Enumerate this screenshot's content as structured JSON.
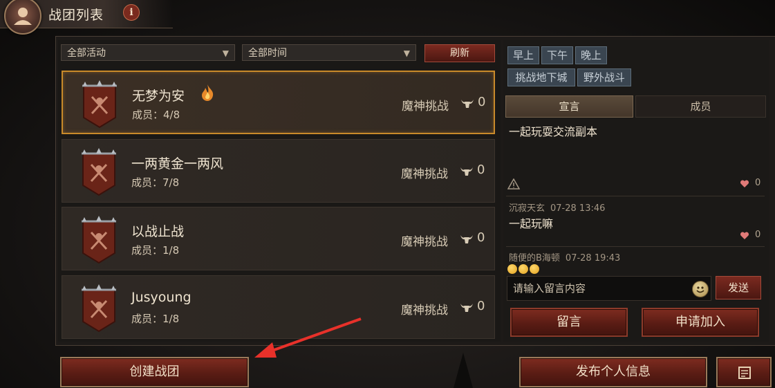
{
  "header": {
    "title": "战团列表",
    "info_label": "i"
  },
  "filters": {
    "activity": "全部活动",
    "time": "全部时间",
    "arrow": "▼",
    "refresh_label": "刷新"
  },
  "teams": [
    {
      "name": "无梦为安",
      "members": "成员：4/8",
      "activity": "魔神挑战",
      "count": "0",
      "selected": true,
      "hot": true
    },
    {
      "name": "一两黄金一两风",
      "members": "成员：7/8",
      "activity": "魔神挑战",
      "count": "0",
      "selected": false,
      "hot": false
    },
    {
      "name": "以战止战",
      "members": "成员：1/8",
      "activity": "魔神挑战",
      "count": "0",
      "selected": false,
      "hot": false
    },
    {
      "name": "Jusyoung",
      "members": "成员：1/8",
      "activity": "魔神挑战",
      "count": "0",
      "selected": false,
      "hot": false
    }
  ],
  "detail": {
    "time_tags": [
      "早上",
      "下午",
      "晚上"
    ],
    "activity_tags": [
      "挑战地下城",
      "野外战斗"
    ],
    "tabs": {
      "declaration": "宣言",
      "members": "成员"
    },
    "declaration": "一起玩耍交流副本",
    "declaration_likes": "0",
    "comments": [
      {
        "author": "沉寂天玄",
        "time": "07-28 13:46",
        "text": "一起玩嘛",
        "likes": "0"
      },
      {
        "author": "随便的B海顿",
        "time": "07-28 19:43",
        "text": ""
      }
    ],
    "message_placeholder": "请输入留言内容",
    "send_label": "发送",
    "leave_message_label": "留言",
    "apply_join_label": "申请加入"
  },
  "bottom": {
    "create_team_label": "创建战团",
    "publish_info_label": "发布个人信息"
  },
  "colors": {
    "accent_gold": "#c98a2a",
    "button_red": "#7b2a20",
    "chip_blue": "#3a4550",
    "arrow_red": "#e8312a"
  }
}
